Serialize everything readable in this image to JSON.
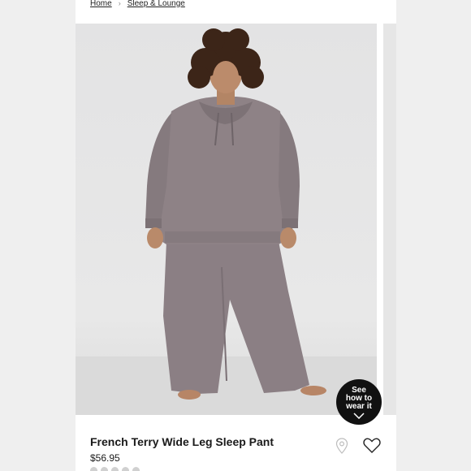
{
  "breadcrumb": {
    "home": "Home",
    "separator": "›",
    "category": "Sleep & Lounge"
  },
  "product": {
    "title": "French Terry Wide Leg Sleep Pant",
    "price": "$56.95",
    "image_alt": "Model wearing a grey french terry hoodie and wide leg sleep pant"
  },
  "badge": {
    "line1": "See",
    "line2": "how to",
    "line3": "wear it"
  },
  "icons": {
    "store": "location-pin-icon",
    "wishlist": "heart-icon",
    "chevron": "chevron-down-icon"
  },
  "colors": {
    "text": "#1a1a1a",
    "badge_bg": "#111111",
    "garment": "#8e8286",
    "background": "#efefef"
  }
}
